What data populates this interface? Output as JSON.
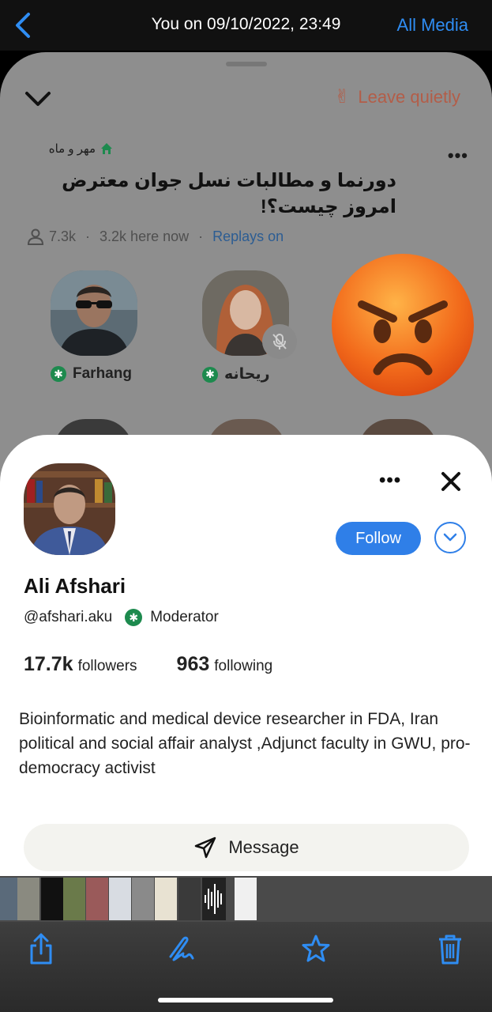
{
  "viewer": {
    "title": "You on 09/10/2022, 23:49",
    "all_media": "All Media"
  },
  "room": {
    "leave_label": "Leave quietly",
    "leave_emoji": "✌",
    "club_name": "مهر و ماه",
    "title": "دورنما و مطالبات نسل جوان معترض امروز چیست؟!",
    "listeners": "7.3k",
    "here_now": "3.2k here now",
    "replays": "Replays on",
    "speakers": [
      {
        "name": "Farhang",
        "moderator": true,
        "muted": false
      },
      {
        "name": "ریحانه",
        "moderator": true,
        "muted": true
      }
    ]
  },
  "profile": {
    "name": "Ali Afshari",
    "handle": "@afshari.aku",
    "role": "Moderator",
    "followers_count": "17.7k",
    "followers_label": "followers",
    "following_count": "963",
    "following_label": "following",
    "bio": "Bioinformatic and medical device researcher in FDA, Iran political and social affair analyst ,Adjunct faculty in GWU, pro-democracy activist",
    "follow_label": "Follow",
    "message_label": "Message"
  },
  "toolbar": {
    "icons": [
      "share-icon",
      "markup-icon",
      "favorite-star-icon",
      "trash-icon"
    ]
  },
  "colors": {
    "accent": "#2f7fe8",
    "ios_blue": "#2f8df3",
    "moderator_green": "#1d8a4e",
    "leave_red": "#b35d48"
  }
}
